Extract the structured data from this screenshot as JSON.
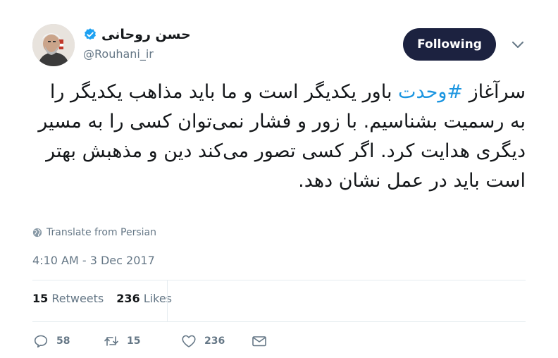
{
  "author": {
    "display_name": "حسن روحانی",
    "handle": "@Rouhani_ir",
    "verified": true,
    "avatar": "avatar-photo"
  },
  "follow_button": {
    "label": "Following"
  },
  "menu": {
    "icon": "chevron-down-icon"
  },
  "tweet": {
    "hashtag": "#وحدت",
    "text_before": "سرآغاز ",
    "text_after": " باور یکدیگر است و ما باید مذاهب یکدیگر را به رسمیت بشناسیم. با زور و فشار نمی‌توان کسی را به مسیر دیگری هدایت کرد. اگر کسی تصور می‌کند دین و مذهبش بهتر است باید در عمل نشان دهد."
  },
  "translate": {
    "label": "Translate from Persian",
    "icon": "globe-icon"
  },
  "timestamp": "4:10 AM - 3 Dec 2017",
  "stats": {
    "retweets_count": "15",
    "retweets_label": "Retweets",
    "likes_count": "236",
    "likes_label": "Likes"
  },
  "actions": {
    "reply_count": "58",
    "retweet_count": "15",
    "like_count": "236"
  },
  "colors": {
    "accent": "#1b95e0",
    "button_bg": "#1c2240",
    "muted": "#657786",
    "verified": "#1da1f2"
  }
}
